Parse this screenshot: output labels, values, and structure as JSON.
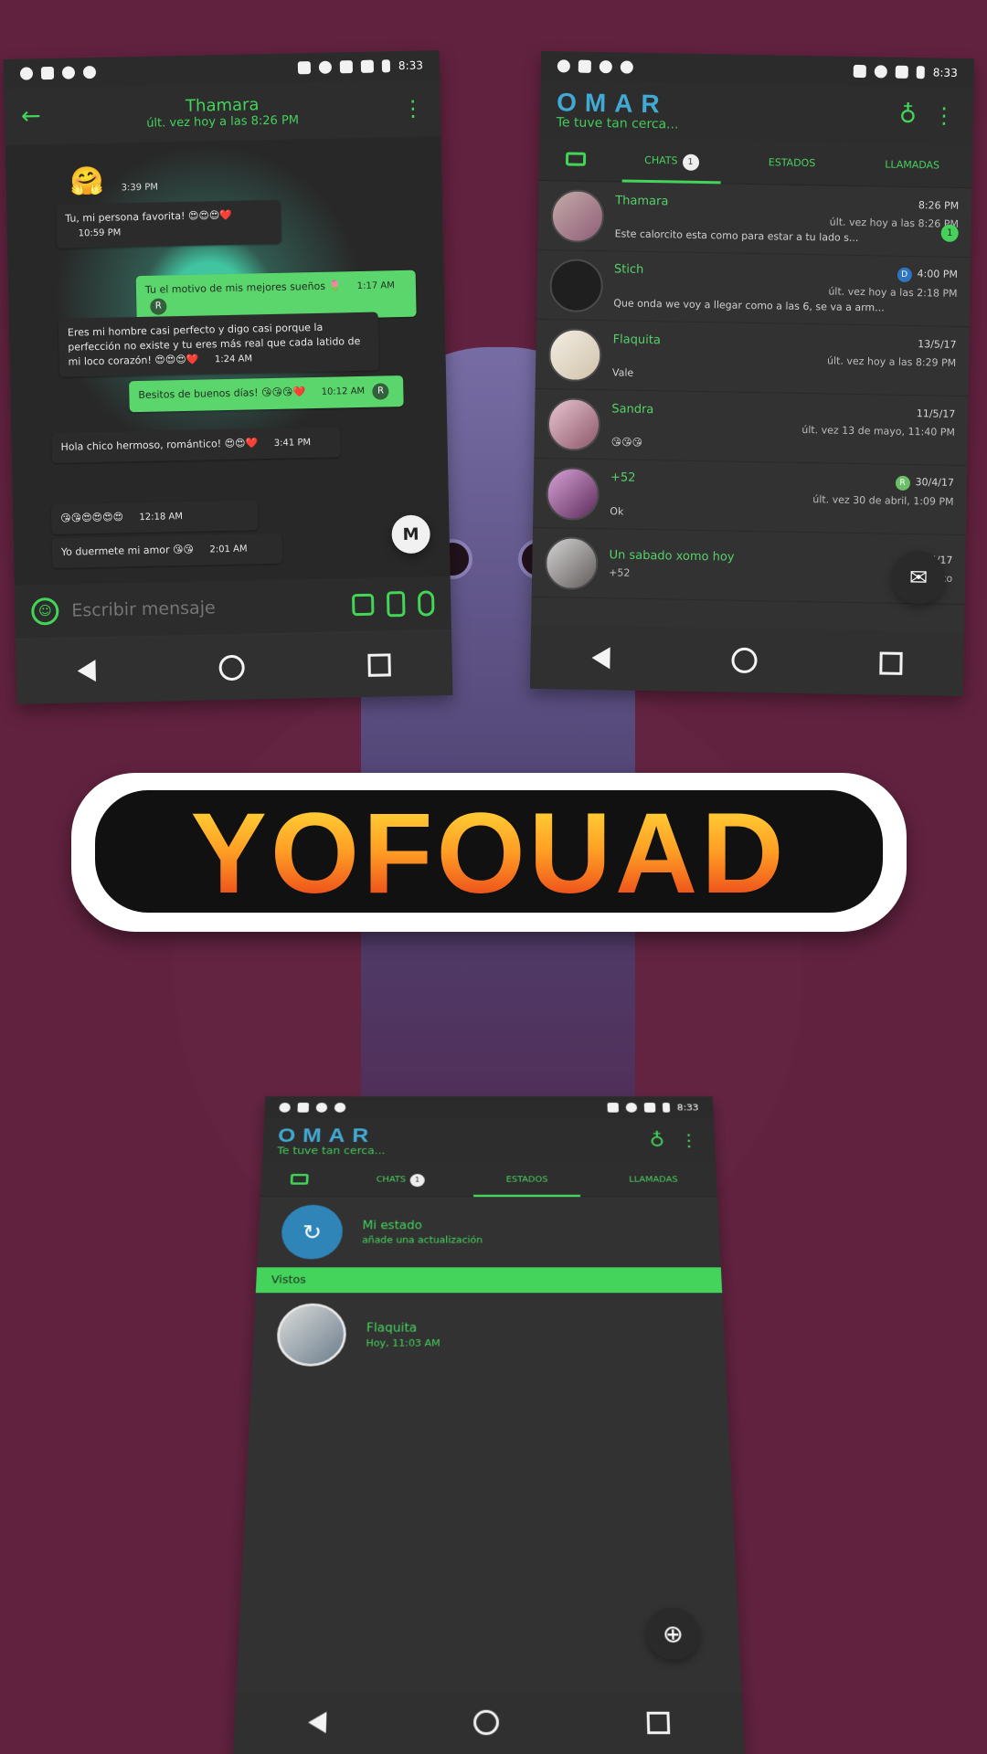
{
  "status_time": "8:33",
  "brand": "YOFOUAD",
  "conversation": {
    "name": "Thamara",
    "last_seen": "últ. vez hoy a las 8:26 PM",
    "messages": [
      {
        "text": "",
        "emoji": "🤗",
        "time": "3:39 PM",
        "side": "in"
      },
      {
        "text": "Tu, mi persona favorita! 😍😍😍❤️",
        "time": "10:59 PM",
        "side": "in"
      },
      {
        "text": "Tu el motivo de mis mejores sueños 🌷",
        "time": "1:17 AM",
        "side": "out",
        "mark": "R"
      },
      {
        "text": "Eres mi hombre casi perfecto y digo casi porque la perfección no existe y tu eres más real que cada latido de mi loco corazón! 😍😍😍❤️",
        "time": "1:24 AM",
        "side": "in"
      },
      {
        "text": "Besitos de buenos días! 😘😘😘❤️",
        "time": "10:12 AM",
        "side": "out",
        "mark": "R"
      },
      {
        "text": "Hola chico hermoso, romántico! 😍😍❤️",
        "time": "3:41 PM",
        "side": "in"
      },
      {
        "text": "😘😘😍😍😍😍",
        "time": "12:18 AM",
        "side": "in"
      },
      {
        "text": "Yo duermete mi amor 😘😘",
        "time": "2:01 AM",
        "side": "in"
      }
    ],
    "input_placeholder": "Escribir mensaje"
  },
  "app": {
    "name": "OMAR",
    "subtitle": "Te tuve tan cerca...",
    "tabs": {
      "chats": "CHATS",
      "chats_badge": "1",
      "states": "ESTADOS",
      "calls": "LLAMADAS"
    }
  },
  "chats": [
    {
      "name": "Thamara",
      "time": "8:26 PM",
      "last_seen": "últ. vez hoy a las 8:26 PM",
      "preview": "Este calorcito esta como para estar a tu lado s...",
      "badge": "1"
    },
    {
      "name": "Stich",
      "time": "4:00 PM",
      "last_seen": "últ. vez hoy a las 2:18 PM",
      "preview": "Que onda we voy a llegar como a las 6, se va a arm...",
      "mark": "D"
    },
    {
      "name": "Flaquita",
      "time": "13/5/17",
      "last_seen": "últ. vez hoy a las 8:29 PM",
      "preview": "Vale"
    },
    {
      "name": "Sandra",
      "time": "11/5/17",
      "last_seen": "últ. vez 13 de mayo, 11:40 PM",
      "preview": "😘😘😘"
    },
    {
      "name": "+52",
      "time": "30/4/17",
      "last_seen": "últ. vez 30 de abril, 1:09 PM",
      "preview": "Ok",
      "mark": "R"
    },
    {
      "name": "Un sabado xomo hoy",
      "time": "4/17",
      "last_seen": "",
      "preview": "+52",
      "photo_label": "Foto"
    }
  ],
  "status_screen": {
    "my_status": "Mi estado",
    "my_status_sub": "añade una actualización",
    "seen_label": "Vistos",
    "viewed_contact": "Flaquita",
    "viewed_time": "Hoy, 11:03 AM"
  },
  "colors": {
    "background": "#61223f",
    "accent": "#44d35b",
    "brand_blue": "#42a9d4"
  }
}
